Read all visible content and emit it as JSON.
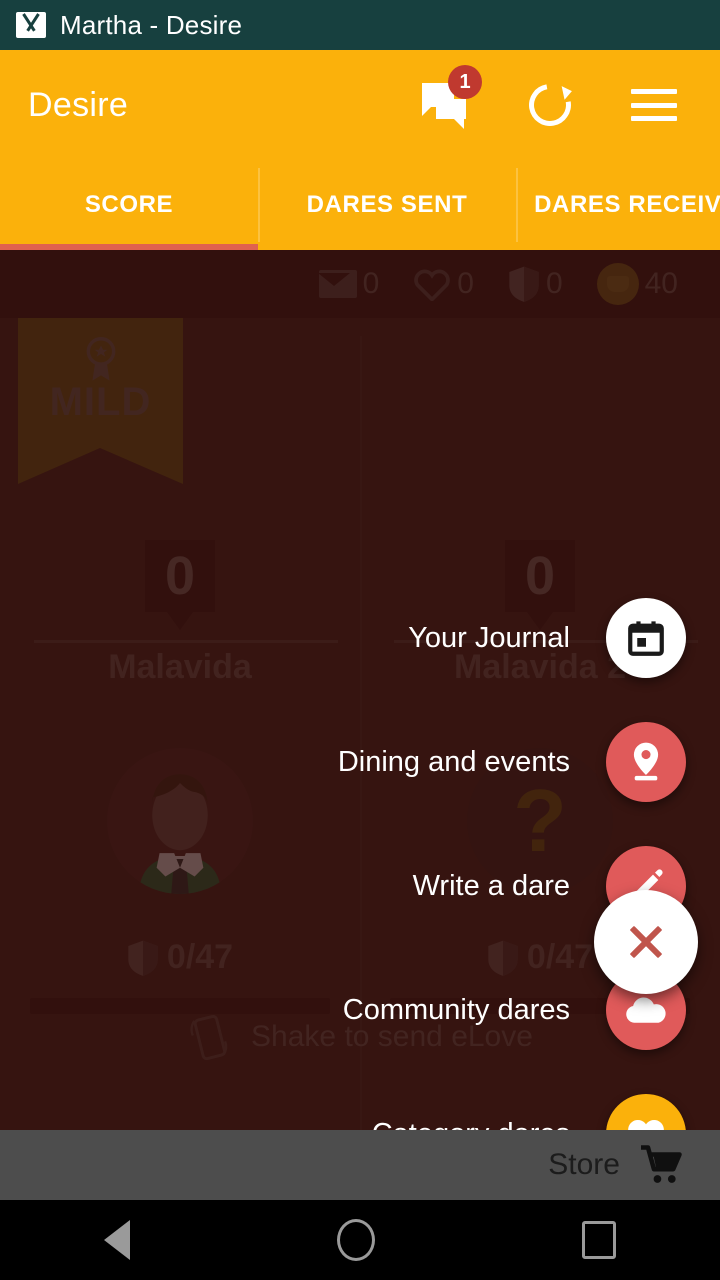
{
  "statusbar": {
    "app_icon": "gmail-icon",
    "title": "Martha - Desire"
  },
  "appbar": {
    "title": "Desire",
    "chat_badge": "1",
    "icons": {
      "chat": "chat-bubbles-icon",
      "refresh": "refresh-icon",
      "menu": "hamburger-menu-icon"
    }
  },
  "tabs": [
    {
      "label": "SCORE",
      "active": true
    },
    {
      "label": "DARES SENT",
      "active": false
    },
    {
      "label": "DARES RECEIVED",
      "active": false
    }
  ],
  "stats": [
    {
      "icon": "envelope-icon",
      "value": "0"
    },
    {
      "icon": "heart-icon",
      "value": "0"
    },
    {
      "icon": "shield-icon",
      "value": "0"
    },
    {
      "icon": "coin-icon",
      "value": "40"
    }
  ],
  "players": [
    {
      "rank_label": "MILD",
      "score": "0",
      "name": "Malavida",
      "avatar": "male-avatar",
      "shield_progress": "0/47"
    },
    {
      "score": "0",
      "name": "Malavida 2",
      "avatar": "unknown-avatar",
      "avatar_placeholder": "?",
      "shield_progress": "0/47"
    }
  ],
  "shake_hint": {
    "icon": "shake-phone-icon",
    "text": "Shake to send eLove"
  },
  "fab_menu": {
    "items": [
      {
        "label": "Your Journal",
        "icon": "calendar-icon",
        "color": "#ffffff"
      },
      {
        "label": "Dining and events",
        "icon": "location-pin-icon",
        "color": "#e05a5a"
      },
      {
        "label": "Write a dare",
        "icon": "pencil-icon",
        "color": "#e05a5a"
      },
      {
        "label": "Community dares",
        "icon": "cloud-icon",
        "color": "#e05a5a"
      },
      {
        "label": "Category dares",
        "icon": "heart-icon",
        "color": "#fbb10b"
      }
    ],
    "main_button": {
      "icon": "close-icon",
      "color": "#ffffff"
    }
  },
  "bottom_bar": {
    "label": "Store",
    "icon": "shopping-cart-icon"
  },
  "navbar": {
    "back": "back-triangle-icon",
    "home": "home-circle-icon",
    "recents": "recents-square-icon"
  },
  "colors": {
    "accent": "#fbb10b",
    "red": "#e05a5a",
    "badge": "#c0392f",
    "background": "#412019",
    "statusbar": "#17403f"
  }
}
